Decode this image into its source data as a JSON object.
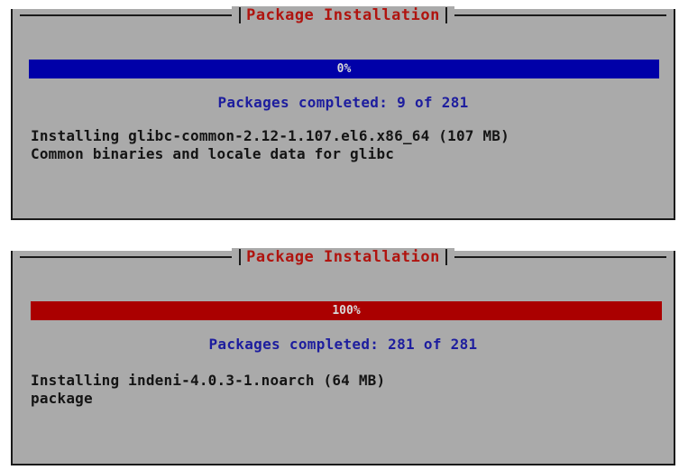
{
  "dialogs": [
    {
      "title": "Package Installation",
      "progress_label": "0%",
      "progress_value": 0,
      "progress_color": "#0000a8",
      "completed_text": "Packages completed: 9 of 281",
      "detail_line1": "Installing glibc-common-2.12-1.107.el6.x86_64 (107 MB)",
      "detail_line2": "Common binaries and locale data for glibc"
    },
    {
      "title": "Package Installation",
      "progress_label": "100%",
      "progress_value": 100,
      "progress_color": "#aa0000",
      "completed_text": "Packages completed: 281 of 281",
      "detail_line1": "Installing indeni-4.0.3-1.noarch (64 MB)",
      "detail_line2": "package"
    }
  ],
  "colors": {
    "dialog_bg": "#aaaaaa",
    "title_fg": "#b0140f",
    "counts_fg": "#1d1d9e",
    "text_fg": "#141414"
  }
}
